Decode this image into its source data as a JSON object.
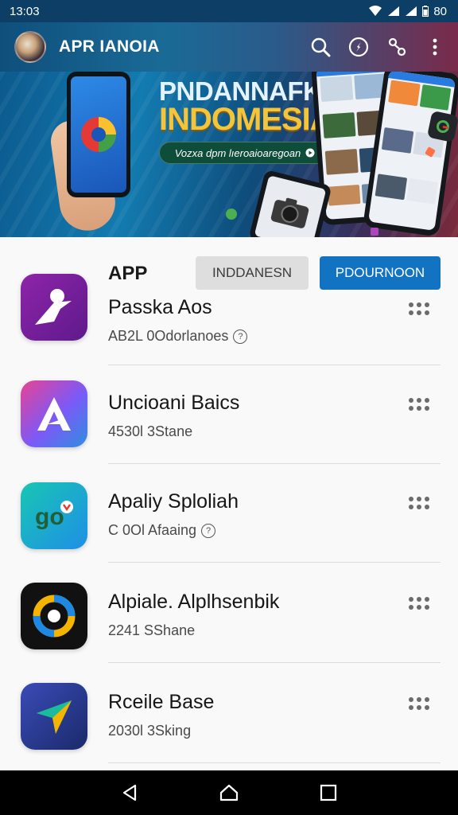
{
  "status_bar": {
    "time": "13:03",
    "battery": "80"
  },
  "app_bar": {
    "title": "APR IANOIA",
    "actions": [
      "search-icon",
      "compass-icon",
      "share-icon",
      "more-vert-icon"
    ]
  },
  "banner": {
    "title_line1": "PNDANNAFK",
    "title_line2": "INDOMESIA",
    "tagline": "Vozxa dpm lıeroaioaregoan"
  },
  "list_header": {
    "title": "APP",
    "button_secondary": "INDDANESN",
    "button_primary": "PDOURNOON"
  },
  "apps": [
    {
      "name": "Passka Aos",
      "meta": "AB2L 0Odorlanoes",
      "has_info": true,
      "icon": "figure-icon"
    },
    {
      "name": "Uncioani Baics",
      "meta": "4530l 3Stane",
      "has_info": false,
      "icon": "triangle-a-icon"
    },
    {
      "name": "Apaliy Sploliah",
      "meta": "C 0Ol Afaaing",
      "has_info": true,
      "icon": "chat-go-icon"
    },
    {
      "name": "Alpiale. Alplhsenbik",
      "meta": "2241 SShane",
      "has_info": false,
      "icon": "ring-icon"
    },
    {
      "name": "Rceile Base",
      "meta": "2030l 3Sking",
      "has_info": false,
      "icon": "arrow-send-icon"
    }
  ],
  "colors": {
    "primary": "#1273c3",
    "status_bar": "#0d3f66"
  },
  "nav": [
    "back-icon",
    "home-icon",
    "recents-icon"
  ]
}
